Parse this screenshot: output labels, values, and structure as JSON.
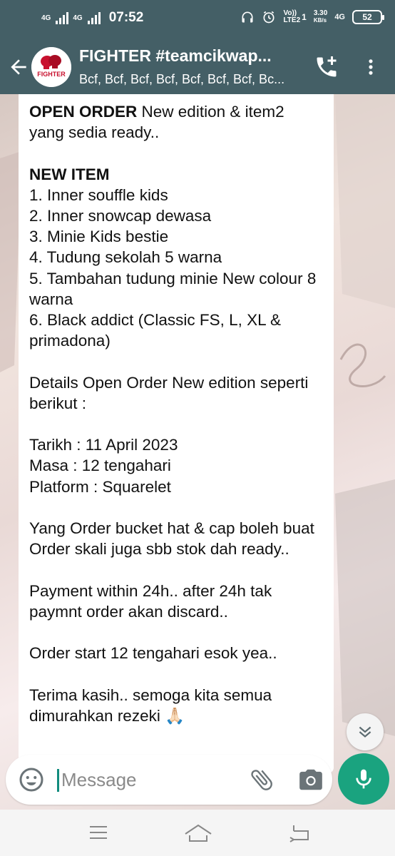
{
  "status_bar": {
    "sim1_label": "4G",
    "sim2_label": "4G",
    "time": "07:52",
    "volte_top": "Vo))",
    "volte_bottom": "LTE2",
    "sim_slot": "1",
    "speed_value": "3.30",
    "speed_unit": "KB/s",
    "network_label": "4G",
    "battery": "52"
  },
  "header": {
    "title": "FIGHTER #teamcikwap...",
    "subtitle": "Bcf, Bcf, Bcf, Bcf, Bcf, Bcf, Bcf, Bc...",
    "avatar_text": "FIGHTER",
    "icons": [
      "back-arrow-icon",
      "add-call-icon",
      "more-vert-icon"
    ]
  },
  "message": {
    "line1_bold": "OPEN ORDER",
    "line1_rest": " New edition & item2",
    "line2": "yang sedia ready..",
    "new_item_heading": "NEW ITEM",
    "items": [
      "1. Inner souffle kids",
      "2. Inner snowcap dewasa",
      "3. Minie Kids bestie",
      "4. Tudung sekolah 5 warna",
      "5. Tambahan tudung minie New colour 8 warna",
      "6. Black addict (Classic FS, L, XL & primadona)"
    ],
    "details": "Details Open Order New edition seperti berikut :",
    "tarikh": "Tarikh : 11 April 2023",
    "masa": "Masa : 12 tengahari",
    "platform": "Platform : Squarelet",
    "bucket": "Yang Order bucket hat & cap boleh buat Order skali juga sbb stok dah ready..",
    "payment": "Payment within 24h.. after 24h tak paymnt order akan discard..",
    "order_start": "Order start 12 tengahari esok yea..",
    "thanks": "Terima kasih.. semoga kita semua dimurahkan rezeki 🙏🏻"
  },
  "input": {
    "placeholder": "Message",
    "value": ""
  },
  "colors": {
    "header_bg": "#445f66",
    "accent_green": "#1aa37f",
    "bubble_bg": "#ffffff"
  }
}
